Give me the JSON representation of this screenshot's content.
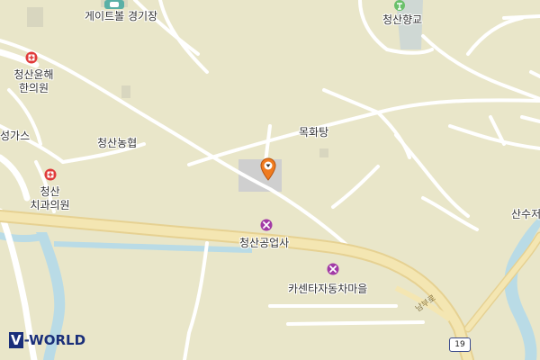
{
  "map": {
    "labels": {
      "gateball": "게이트볼 경기장",
      "hyanggyo": "청산향교",
      "clinic_name_1": "청산윤해",
      "clinic_name_2": "한의원",
      "gas": "성가스",
      "nonghyup": "청산농협",
      "dental_1": "청산",
      "dental_2": "치과의원",
      "bathhouse": "목화탕",
      "industrial": "청산공업사",
      "carcenter": "카센타자동차마을",
      "sansu": "산수저",
      "road_name": "남부로"
    },
    "route_number": "19",
    "logo": {
      "prefix": "V",
      "suffix": "-WORLD"
    },
    "colors": {
      "land": "#e9e6c9",
      "road": "#ffffff",
      "main_road": "#f4e6b2",
      "water": "#b9dbe6",
      "building": "#cfcfcf",
      "marker": "#f07b1f",
      "hospital_red": "#e03a3a",
      "repair_purple": "#a23aa6"
    }
  }
}
